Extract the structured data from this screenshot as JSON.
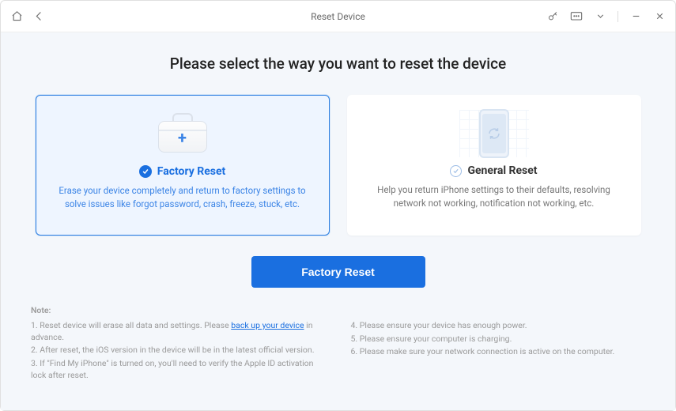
{
  "titlebar": {
    "title": "Reset Device"
  },
  "headline": "Please select the way you want to reset the device",
  "cards": {
    "factory": {
      "title": "Factory Reset",
      "desc": "Erase your device completely and return to factory settings to solve issues like forgot password, crash, freeze, stuck, etc."
    },
    "general": {
      "title": "General Reset",
      "desc": "Help you return iPhone settings to their defaults, resolving network not working, notification not working, etc."
    }
  },
  "action": {
    "label": "Factory Reset"
  },
  "notes": {
    "title": "Note:",
    "left": {
      "l1a": "1. Reset device will erase all data and settings. Please ",
      "l1link": "back up your device",
      "l1b": " in advance.",
      "l2": "2. After reset, the iOS version in the device will be in the latest official version.",
      "l3": "3. If \"Find My iPhone\" is turned on, you'll need to verify the Apple ID activation lock after reset."
    },
    "right": {
      "l4": "4. Please ensure your device has enough power.",
      "l5": "5. Please ensure your computer is charging.",
      "l6": "6. Please make sure your network connection is active on the computer."
    }
  }
}
